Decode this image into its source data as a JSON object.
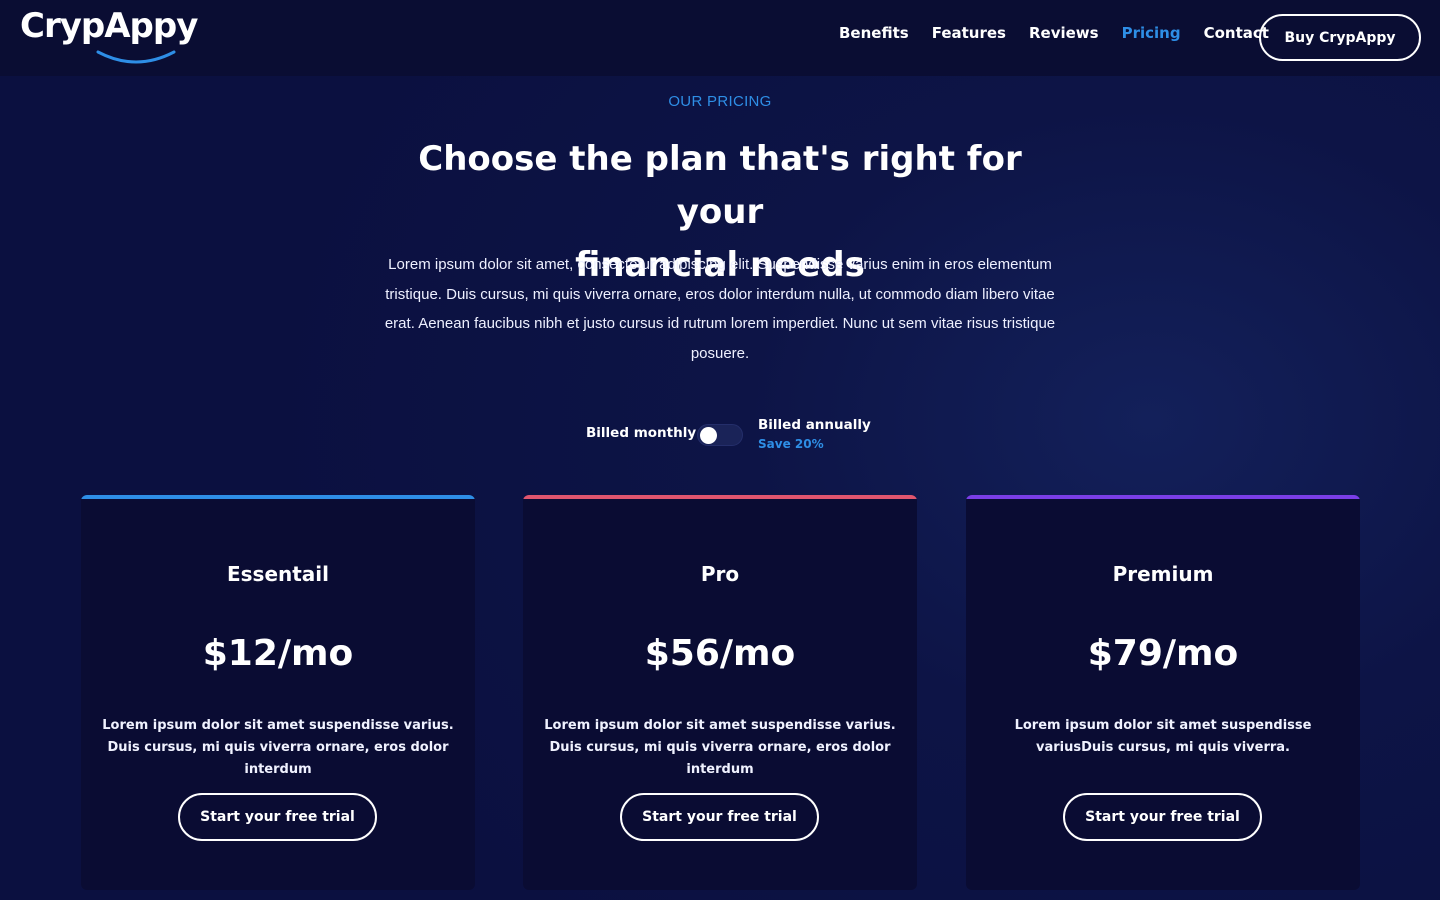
{
  "header": {
    "logo_text": "CrypAppy",
    "nav": [
      {
        "label": "Benefits",
        "active": false
      },
      {
        "label": "Features",
        "active": false
      },
      {
        "label": "Reviews",
        "active": false
      },
      {
        "label": "Pricing",
        "active": true
      },
      {
        "label": "Contact",
        "active": false
      }
    ],
    "cta_label": "Buy CrypAppy"
  },
  "pricing": {
    "eyebrow": "OUR PRICING",
    "headline_line1": "Choose the plan that's right for your",
    "headline_line2": "financial needs",
    "intro": "Lorem ipsum dolor sit amet, consectetur adipiscing elit. Suspendisse varius enim in eros elementum tristique. Duis cursus, mi quis viverra ornare, eros dolor interdum nulla, ut commodo diam libero vitae erat. Aenean faucibus nibh et justo cursus id rutrum lorem imperdiet. Nunc ut sem vitae risus tristique posuere.",
    "billing": {
      "monthly_label": "Billed monthly",
      "annual_label": "Billed annually",
      "save_label": "Save 20%",
      "toggle_state": "monthly"
    },
    "plans": [
      {
        "name": "Essentail",
        "price": "$12/mo",
        "description": "Lorem ipsum dolor sit amet suspendisse varius. Duis cursus, mi quis viverra ornare, eros dolor interdum",
        "button_label": "Start your free trial",
        "accent_color": "#2e8ee6"
      },
      {
        "name": "Pro",
        "price": "$56/mo",
        "description": "Lorem ipsum dolor sit amet suspendisse varius. Duis cursus, mi quis viverra ornare, eros dolor interdum",
        "button_label": "Start your free trial",
        "accent_color": "#e0556e"
      },
      {
        "name": "Premium",
        "price": "$79/mo",
        "description": "Lorem ipsum dolor sit amet suspendisse variusDuis cursus, mi quis viverra.",
        "button_label": "Start your free trial",
        "accent_color": "#7a3ee6"
      }
    ]
  },
  "colors": {
    "accent_blue": "#2e8ee6",
    "background": "#0b1040",
    "card_background": "#0a0c33"
  },
  "icons": {
    "logo_smile": "smile-arc-icon"
  }
}
